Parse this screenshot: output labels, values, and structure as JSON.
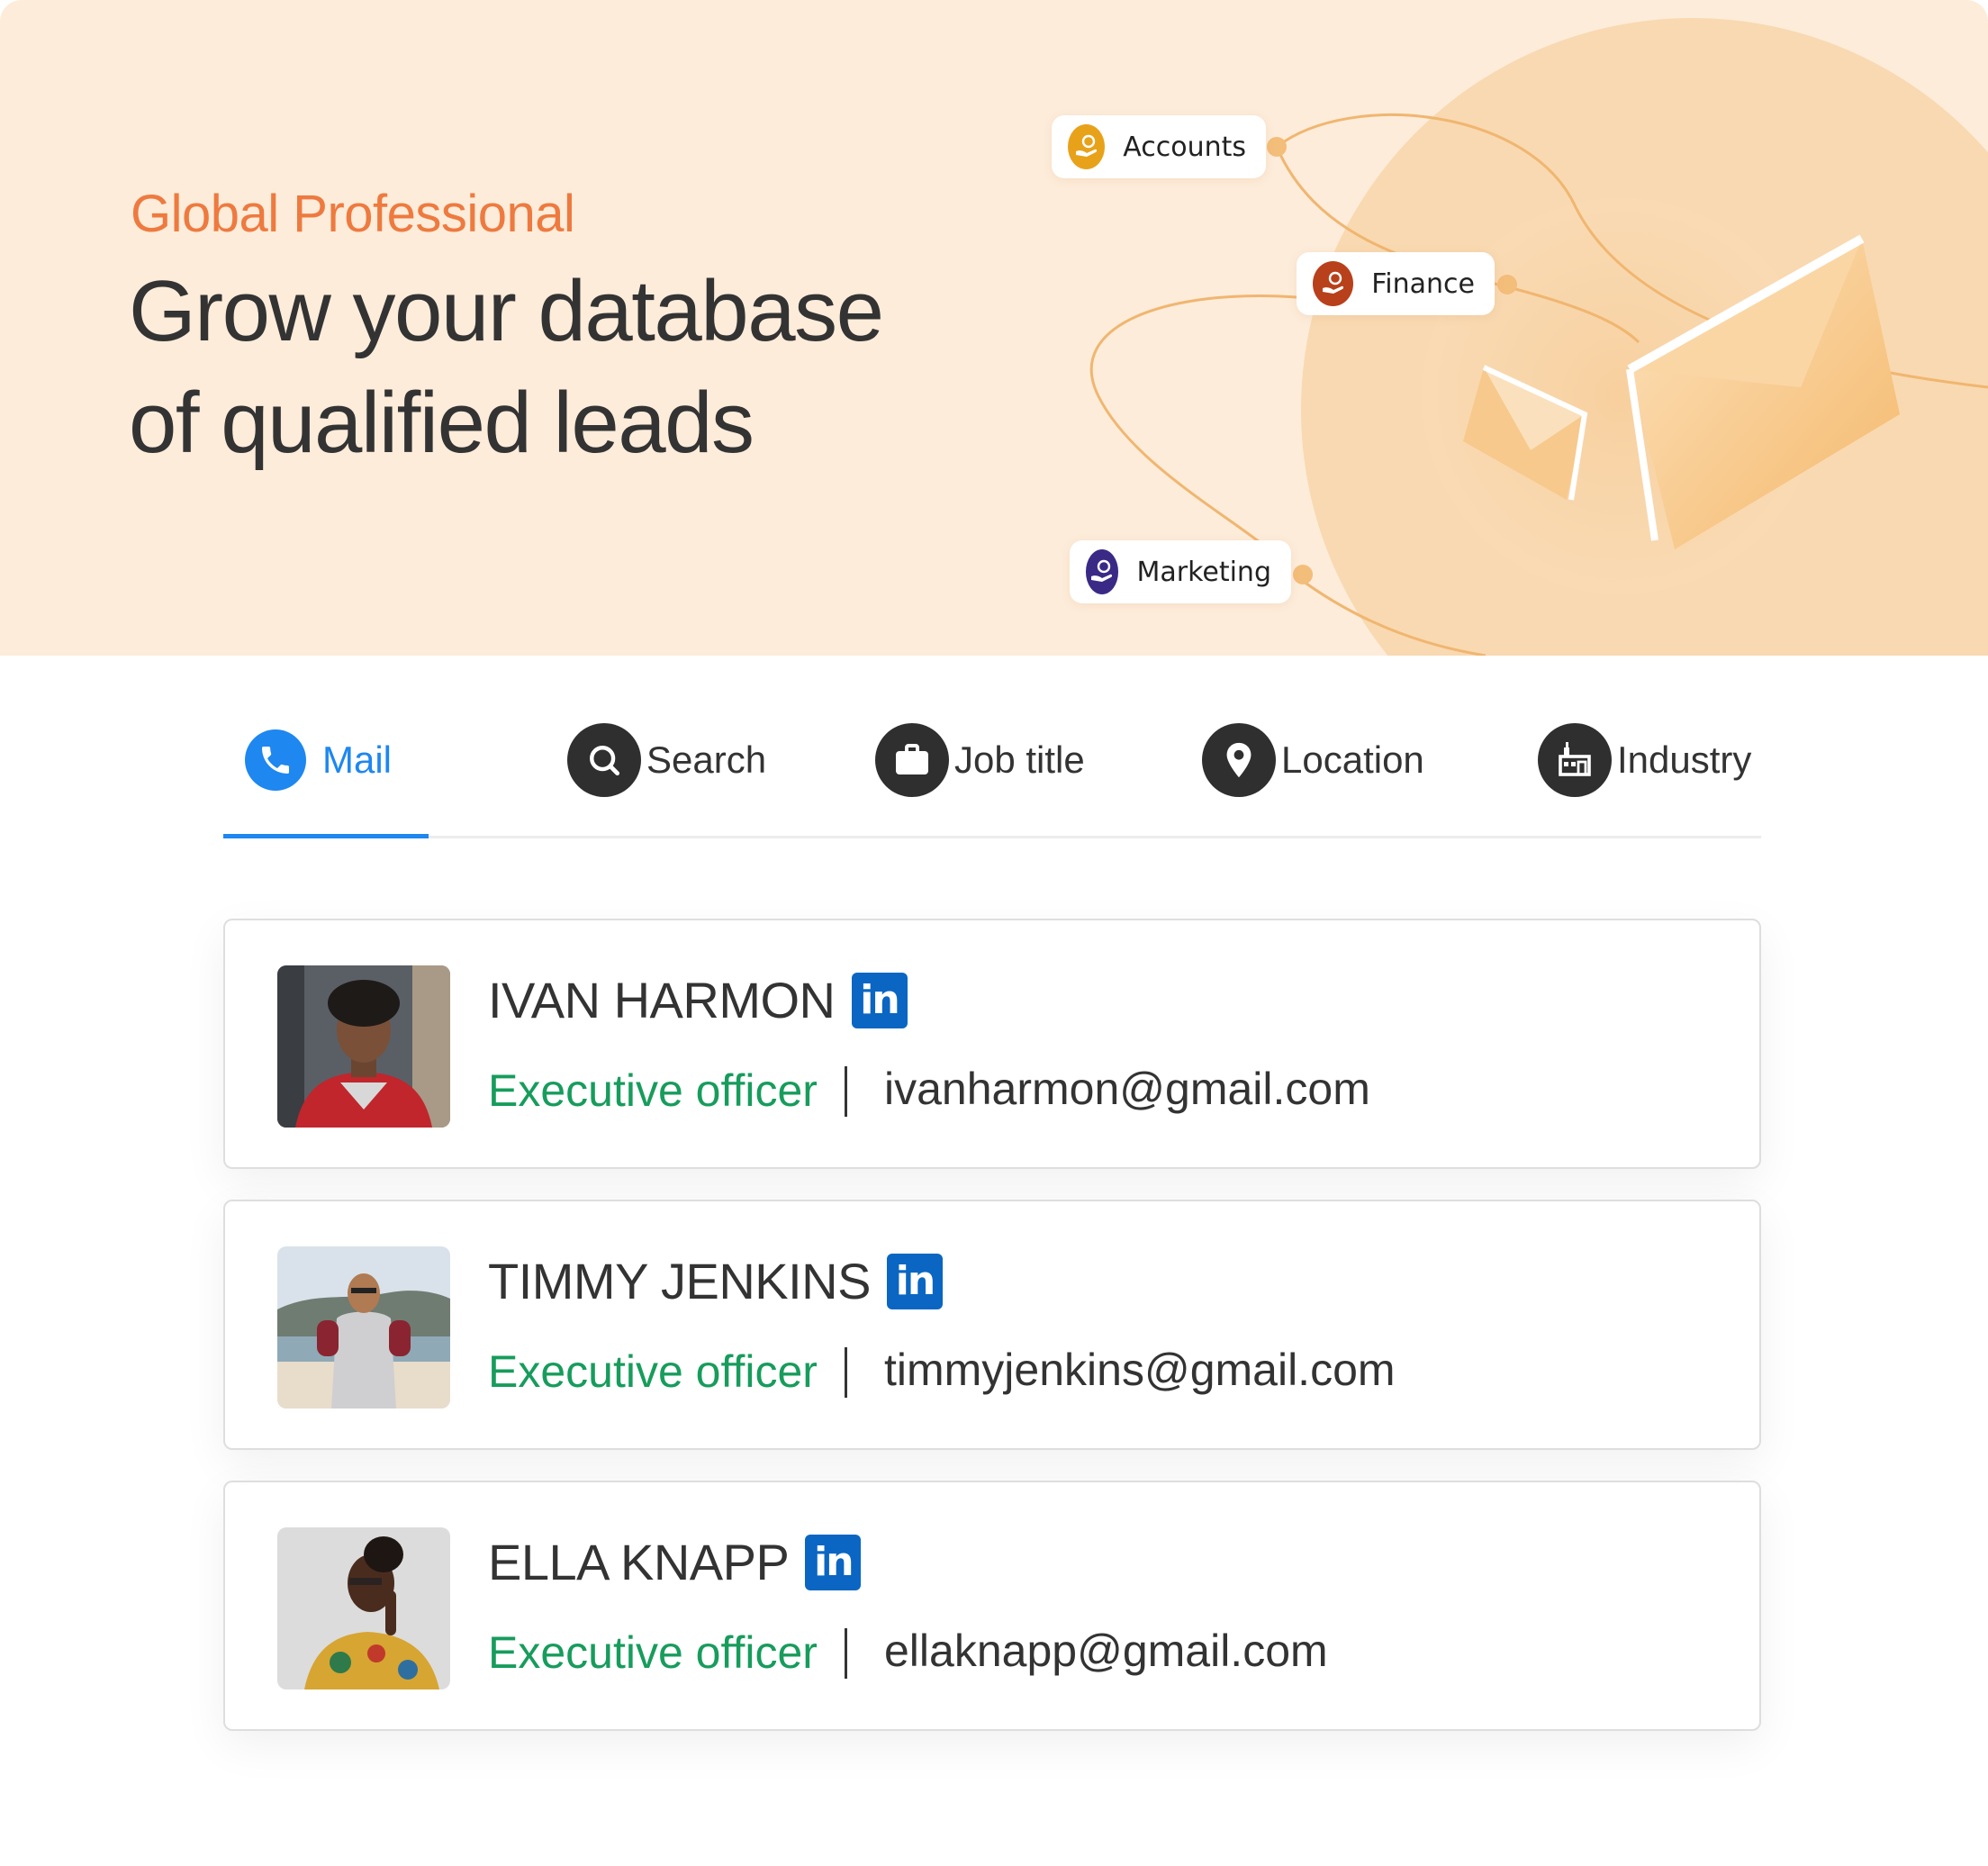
{
  "hero": {
    "eyebrow": "Global Professional",
    "headline_line1": "Grow your database",
    "headline_line2": "of qualified leads",
    "pills": [
      {
        "label": "Accounts",
        "icon": "money-hand-icon",
        "color": "#e8a21a"
      },
      {
        "label": "Finance",
        "icon": "money-hand-icon",
        "color": "#b8401a"
      },
      {
        "label": "Marketing",
        "icon": "money-hand-icon",
        "color": "#3a2a86"
      }
    ],
    "colors": {
      "background": "#fdecda",
      "eyebrow": "#ee7a3f",
      "headline": "#333333"
    }
  },
  "tabs": [
    {
      "label": "Mail",
      "icon": "phone-icon",
      "active": true
    },
    {
      "label": "Search",
      "icon": "search-icon",
      "active": false
    },
    {
      "label": "Job title",
      "icon": "briefcase-icon",
      "active": false
    },
    {
      "label": "Location",
      "icon": "location-pin-icon",
      "active": false
    },
    {
      "label": "Industry",
      "icon": "factory-icon",
      "active": false
    }
  ],
  "contacts": [
    {
      "name": "IVAN HARMON",
      "role": "Executive officer",
      "email": "ivanharmon@gmail.com",
      "social": "in"
    },
    {
      "name": "TIMMY JENKINS",
      "role": "Executive officer",
      "email": "timmyjenkins@gmail.com",
      "social": "in"
    },
    {
      "name": "ELLA KNAPP",
      "role": "Executive officer",
      "email": "ellaknapp@gmail.com",
      "social": "in"
    }
  ],
  "colors": {
    "accent": "#1e87f0",
    "role": "#179c5c",
    "linkedin": "#0a66c2"
  }
}
